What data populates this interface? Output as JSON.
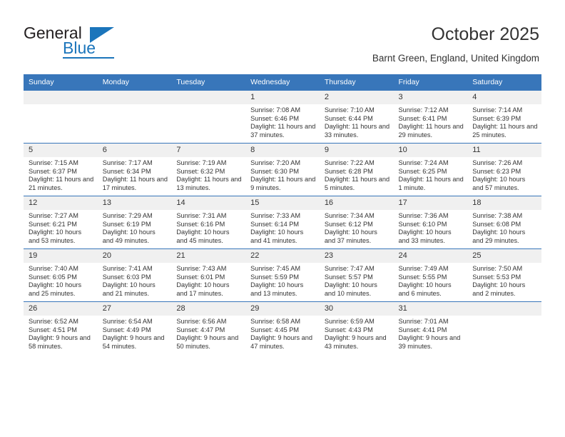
{
  "brand": {
    "name_part1": "General",
    "name_part2": "Blue",
    "logo_icon": "blue-triangle-logo"
  },
  "header": {
    "title": "October 2025",
    "subtitle": "Barnt Green, England, United Kingdom"
  },
  "colors": {
    "header_blue": "#3876ba",
    "brand_blue": "#1b75bb",
    "daynum_band": "#f0f0f0",
    "text": "#333333"
  },
  "weekdays": [
    "Sunday",
    "Monday",
    "Tuesday",
    "Wednesday",
    "Thursday",
    "Friday",
    "Saturday"
  ],
  "labels": {
    "sunrise": "Sunrise:",
    "sunset": "Sunset:",
    "daylight": "Daylight:"
  },
  "weeks": [
    [
      {
        "day": "",
        "sunrise": "",
        "sunset": "",
        "daylight": ""
      },
      {
        "day": "",
        "sunrise": "",
        "sunset": "",
        "daylight": ""
      },
      {
        "day": "",
        "sunrise": "",
        "sunset": "",
        "daylight": ""
      },
      {
        "day": "1",
        "sunrise": "Sunrise: 7:08 AM",
        "sunset": "Sunset: 6:46 PM",
        "daylight": "Daylight: 11 hours and 37 minutes."
      },
      {
        "day": "2",
        "sunrise": "Sunrise: 7:10 AM",
        "sunset": "Sunset: 6:44 PM",
        "daylight": "Daylight: 11 hours and 33 minutes."
      },
      {
        "day": "3",
        "sunrise": "Sunrise: 7:12 AM",
        "sunset": "Sunset: 6:41 PM",
        "daylight": "Daylight: 11 hours and 29 minutes."
      },
      {
        "day": "4",
        "sunrise": "Sunrise: 7:14 AM",
        "sunset": "Sunset: 6:39 PM",
        "daylight": "Daylight: 11 hours and 25 minutes."
      }
    ],
    [
      {
        "day": "5",
        "sunrise": "Sunrise: 7:15 AM",
        "sunset": "Sunset: 6:37 PM",
        "daylight": "Daylight: 11 hours and 21 minutes."
      },
      {
        "day": "6",
        "sunrise": "Sunrise: 7:17 AM",
        "sunset": "Sunset: 6:34 PM",
        "daylight": "Daylight: 11 hours and 17 minutes."
      },
      {
        "day": "7",
        "sunrise": "Sunrise: 7:19 AM",
        "sunset": "Sunset: 6:32 PM",
        "daylight": "Daylight: 11 hours and 13 minutes."
      },
      {
        "day": "8",
        "sunrise": "Sunrise: 7:20 AM",
        "sunset": "Sunset: 6:30 PM",
        "daylight": "Daylight: 11 hours and 9 minutes."
      },
      {
        "day": "9",
        "sunrise": "Sunrise: 7:22 AM",
        "sunset": "Sunset: 6:28 PM",
        "daylight": "Daylight: 11 hours and 5 minutes."
      },
      {
        "day": "10",
        "sunrise": "Sunrise: 7:24 AM",
        "sunset": "Sunset: 6:25 PM",
        "daylight": "Daylight: 11 hours and 1 minute."
      },
      {
        "day": "11",
        "sunrise": "Sunrise: 7:26 AM",
        "sunset": "Sunset: 6:23 PM",
        "daylight": "Daylight: 10 hours and 57 minutes."
      }
    ],
    [
      {
        "day": "12",
        "sunrise": "Sunrise: 7:27 AM",
        "sunset": "Sunset: 6:21 PM",
        "daylight": "Daylight: 10 hours and 53 minutes."
      },
      {
        "day": "13",
        "sunrise": "Sunrise: 7:29 AM",
        "sunset": "Sunset: 6:19 PM",
        "daylight": "Daylight: 10 hours and 49 minutes."
      },
      {
        "day": "14",
        "sunrise": "Sunrise: 7:31 AM",
        "sunset": "Sunset: 6:16 PM",
        "daylight": "Daylight: 10 hours and 45 minutes."
      },
      {
        "day": "15",
        "sunrise": "Sunrise: 7:33 AM",
        "sunset": "Sunset: 6:14 PM",
        "daylight": "Daylight: 10 hours and 41 minutes."
      },
      {
        "day": "16",
        "sunrise": "Sunrise: 7:34 AM",
        "sunset": "Sunset: 6:12 PM",
        "daylight": "Daylight: 10 hours and 37 minutes."
      },
      {
        "day": "17",
        "sunrise": "Sunrise: 7:36 AM",
        "sunset": "Sunset: 6:10 PM",
        "daylight": "Daylight: 10 hours and 33 minutes."
      },
      {
        "day": "18",
        "sunrise": "Sunrise: 7:38 AM",
        "sunset": "Sunset: 6:08 PM",
        "daylight": "Daylight: 10 hours and 29 minutes."
      }
    ],
    [
      {
        "day": "19",
        "sunrise": "Sunrise: 7:40 AM",
        "sunset": "Sunset: 6:05 PM",
        "daylight": "Daylight: 10 hours and 25 minutes."
      },
      {
        "day": "20",
        "sunrise": "Sunrise: 7:41 AM",
        "sunset": "Sunset: 6:03 PM",
        "daylight": "Daylight: 10 hours and 21 minutes."
      },
      {
        "day": "21",
        "sunrise": "Sunrise: 7:43 AM",
        "sunset": "Sunset: 6:01 PM",
        "daylight": "Daylight: 10 hours and 17 minutes."
      },
      {
        "day": "22",
        "sunrise": "Sunrise: 7:45 AM",
        "sunset": "Sunset: 5:59 PM",
        "daylight": "Daylight: 10 hours and 13 minutes."
      },
      {
        "day": "23",
        "sunrise": "Sunrise: 7:47 AM",
        "sunset": "Sunset: 5:57 PM",
        "daylight": "Daylight: 10 hours and 10 minutes."
      },
      {
        "day": "24",
        "sunrise": "Sunrise: 7:49 AM",
        "sunset": "Sunset: 5:55 PM",
        "daylight": "Daylight: 10 hours and 6 minutes."
      },
      {
        "day": "25",
        "sunrise": "Sunrise: 7:50 AM",
        "sunset": "Sunset: 5:53 PM",
        "daylight": "Daylight: 10 hours and 2 minutes."
      }
    ],
    [
      {
        "day": "26",
        "sunrise": "Sunrise: 6:52 AM",
        "sunset": "Sunset: 4:51 PM",
        "daylight": "Daylight: 9 hours and 58 minutes."
      },
      {
        "day": "27",
        "sunrise": "Sunrise: 6:54 AM",
        "sunset": "Sunset: 4:49 PM",
        "daylight": "Daylight: 9 hours and 54 minutes."
      },
      {
        "day": "28",
        "sunrise": "Sunrise: 6:56 AM",
        "sunset": "Sunset: 4:47 PM",
        "daylight": "Daylight: 9 hours and 50 minutes."
      },
      {
        "day": "29",
        "sunrise": "Sunrise: 6:58 AM",
        "sunset": "Sunset: 4:45 PM",
        "daylight": "Daylight: 9 hours and 47 minutes."
      },
      {
        "day": "30",
        "sunrise": "Sunrise: 6:59 AM",
        "sunset": "Sunset: 4:43 PM",
        "daylight": "Daylight: 9 hours and 43 minutes."
      },
      {
        "day": "31",
        "sunrise": "Sunrise: 7:01 AM",
        "sunset": "Sunset: 4:41 PM",
        "daylight": "Daylight: 9 hours and 39 minutes."
      },
      {
        "day": "",
        "sunrise": "",
        "sunset": "",
        "daylight": ""
      }
    ]
  ]
}
